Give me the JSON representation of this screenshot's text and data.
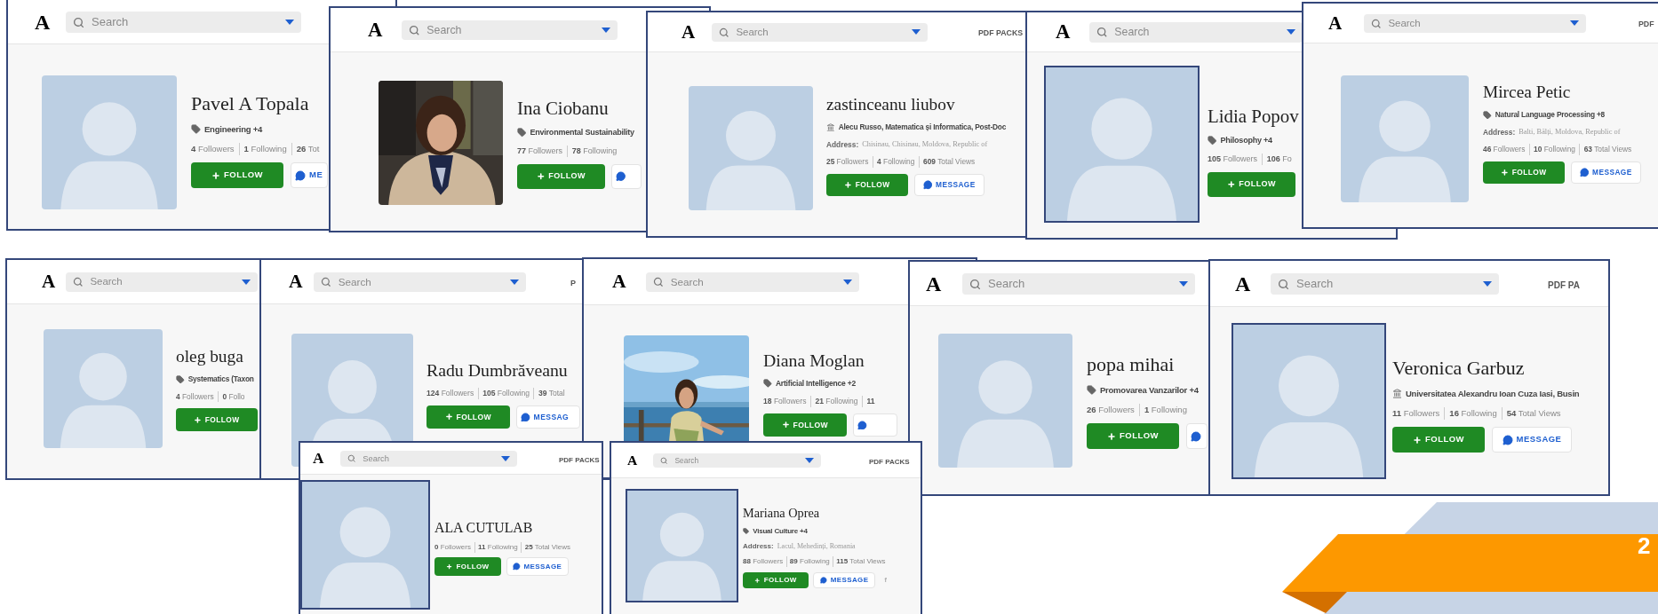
{
  "cards": [
    {
      "logo": "A",
      "search": {
        "placeholder": "Search"
      },
      "avatar": {
        "kind": "placeholder",
        "framed": false
      },
      "name": "Pavel A Topala",
      "affiliation": {
        "kind": "tag",
        "text": "Engineering +4"
      },
      "stats": [
        {
          "count": "4",
          "label": "Followers"
        },
        {
          "count": "1",
          "label": "Following"
        },
        {
          "count": "26",
          "label": "Tot"
        }
      ],
      "follow": "FOLLOW",
      "message": {
        "kind": "labeled",
        "label": "ME"
      }
    },
    {
      "logo": "A",
      "search": {
        "placeholder": "Search"
      },
      "avatar": {
        "kind": "picture",
        "framed": false
      },
      "name": "Ina Ciobanu",
      "affiliation": {
        "kind": "tag",
        "text": "Environmental Sustainability"
      },
      "stats": [
        {
          "count": "77",
          "label": "Followers"
        },
        {
          "count": "78",
          "label": "Following"
        }
      ],
      "follow": "FOLLOW",
      "message": {
        "kind": "icon"
      }
    },
    {
      "logo": "A",
      "search": {
        "placeholder": "Search"
      },
      "pdf_packs": "PDF PACKS",
      "avatar": {
        "kind": "placeholder",
        "framed": false
      },
      "name": "zastinceanu liubov",
      "affiliation": {
        "kind": "institution",
        "text": "Alecu Russo, Matematica și Informatica, Post-Doc"
      },
      "address": {
        "label": "Address:",
        "value": "Chisinau, Chisinau, Moldova, Republic of"
      },
      "stats": [
        {
          "count": "25",
          "label": "Followers"
        },
        {
          "count": "4",
          "label": "Following"
        },
        {
          "count": "609",
          "label": "Total Views"
        }
      ],
      "follow": "FOLLOW",
      "message": {
        "kind": "labeled",
        "label": "MESSAGE"
      }
    },
    {
      "logo": "A",
      "search": {
        "placeholder": "Search"
      },
      "avatar": {
        "kind": "placeholder",
        "framed": true
      },
      "name": "Lidia Popov",
      "affiliation": {
        "kind": "tag",
        "text": "Philosophy +4"
      },
      "stats": [
        {
          "count": "105",
          "label": "Followers"
        },
        {
          "count": "106",
          "label": "Fo"
        }
      ],
      "follow": "FOLLOW"
    },
    {
      "logo": "A",
      "search": {
        "placeholder": "Search"
      },
      "pdf_packs": "PDF",
      "avatar": {
        "kind": "placeholder",
        "framed": false
      },
      "name": "Mircea Petic",
      "affiliation": {
        "kind": "tag",
        "text": "Natural Language Processing +8"
      },
      "address": {
        "label": "Address:",
        "value": "Balti, Bălți, Moldova, Republic of"
      },
      "stats": [
        {
          "count": "46",
          "label": "Followers"
        },
        {
          "count": "10",
          "label": "Following"
        },
        {
          "count": "63",
          "label": "Total Views"
        }
      ],
      "follow": "FOLLOW",
      "message": {
        "kind": "labeled",
        "label": "MESSAGE"
      }
    },
    {
      "logo": "A",
      "search": {
        "placeholder": "Search"
      },
      "avatar": {
        "kind": "placeholder",
        "framed": false
      },
      "name": "oleg buga",
      "affiliation": {
        "kind": "tag",
        "text": "Systematics (Taxon"
      },
      "stats": [
        {
          "count": "4",
          "label": "Followers"
        },
        {
          "count": "0",
          "label": "Follo"
        }
      ],
      "follow": "FOLLOW"
    },
    {
      "logo": "A",
      "search": {
        "placeholder": "Search"
      },
      "pdf_packs": "P",
      "avatar": {
        "kind": "placeholder",
        "framed": false
      },
      "name": "Radu Dumbrăveanu",
      "stats": [
        {
          "count": "124",
          "label": "Followers"
        },
        {
          "count": "105",
          "label": "Following"
        },
        {
          "count": "39",
          "label": "Total"
        }
      ],
      "follow": "FOLLOW",
      "message": {
        "kind": "labeled",
        "label": "MESSAG"
      }
    },
    {
      "logo": "A",
      "search": {
        "placeholder": "Search"
      },
      "avatar": {
        "kind": "picture",
        "framed": false
      },
      "name": "Diana Moglan",
      "affiliation": {
        "kind": "tag",
        "text": "Artificial Intelligence +2"
      },
      "stats": [
        {
          "count": "18",
          "label": "Followers"
        },
        {
          "count": "21",
          "label": "Following"
        },
        {
          "count": "11"
        }
      ],
      "follow": "FOLLOW",
      "message": {
        "kind": "icon"
      }
    },
    {
      "logo": "A",
      "search": {
        "placeholder": "Search"
      },
      "avatar": {
        "kind": "placeholder",
        "framed": false
      },
      "name": "popa mihai",
      "affiliation": {
        "kind": "tag",
        "text": "Promovarea Vanzarilor +4"
      },
      "stats": [
        {
          "count": "26",
          "label": "Followers"
        },
        {
          "count": "1",
          "label": "Following"
        }
      ],
      "follow": "FOLLOW",
      "message": {
        "kind": "icon"
      }
    },
    {
      "logo": "A",
      "search": {
        "placeholder": "Search"
      },
      "pdf_packs": "PDF PA",
      "avatar": {
        "kind": "placeholder",
        "framed": true
      },
      "name": "Veronica Garbuz",
      "affiliation": {
        "kind": "institution",
        "text": "Universitatea Alexandru Ioan Cuza Iasi, Busin"
      },
      "stats": [
        {
          "count": "11",
          "label": "Followers"
        },
        {
          "count": "16",
          "label": "Following"
        },
        {
          "count": "54",
          "label": "Total Views"
        }
      ],
      "follow": "FOLLOW",
      "message": {
        "kind": "labeled",
        "label": "MESSAGE"
      }
    },
    {
      "logo": "A",
      "search": {
        "placeholder": "Search"
      },
      "pdf_packs": "PDF PACKS",
      "avatar": {
        "kind": "placeholder",
        "framed": true
      },
      "name": "ALA CUTULAB",
      "stats": [
        {
          "count": "0",
          "label": "Followers"
        },
        {
          "count": "11",
          "label": "Following"
        },
        {
          "count": "25",
          "label": "Total Views"
        }
      ],
      "follow": "FOLLOW",
      "message": {
        "kind": "labeled",
        "label": "MESSAGE"
      }
    },
    {
      "logo": "A",
      "search": {
        "placeholder": "Search"
      },
      "pdf_packs": "PDF PACKS",
      "avatar": {
        "kind": "placeholder",
        "framed": true
      },
      "name": "Mariana Oprea",
      "affiliation": {
        "kind": "tag",
        "text": "Visual Culture +4"
      },
      "address": {
        "label": "Address:",
        "value": "Lacul, Mehedinți, Romania"
      },
      "stats": [
        {
          "count": "88",
          "label": "Followers"
        },
        {
          "count": "89",
          "label": "Following"
        },
        {
          "count": "115",
          "label": "Total Views"
        }
      ],
      "follow": "FOLLOW",
      "message": {
        "kind": "labeled",
        "label": "MESSAGE"
      },
      "social": "f"
    }
  ],
  "banner": {
    "text": "2"
  }
}
